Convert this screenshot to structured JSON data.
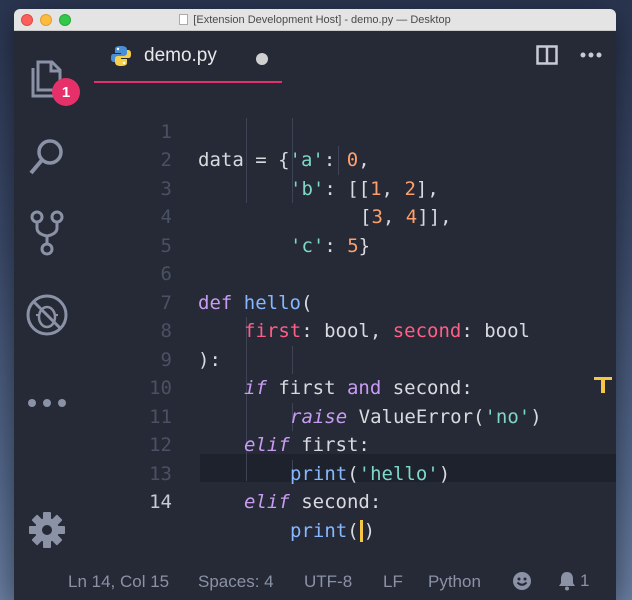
{
  "window": {
    "title": "[Extension Development Host] - demo.py — Desktop"
  },
  "activity": {
    "badge_count": "1"
  },
  "tab": {
    "label": "demo.py"
  },
  "code": {
    "lines": [
      {
        "num": "1"
      },
      {
        "num": "2"
      },
      {
        "num": "3"
      },
      {
        "num": "4"
      },
      {
        "num": "5"
      },
      {
        "num": "6"
      },
      {
        "num": "7"
      },
      {
        "num": "8"
      },
      {
        "num": "9"
      },
      {
        "num": "10"
      },
      {
        "num": "11"
      },
      {
        "num": "12"
      },
      {
        "num": "13"
      },
      {
        "num": "14"
      }
    ],
    "active_line": "14",
    "tokens": {
      "l1": [
        "data = {",
        "'a'",
        ": ",
        "0",
        ","
      ],
      "l2": [
        "'b'",
        ": [[",
        "1",
        ", ",
        "2",
        "],"
      ],
      "l3": [
        "[",
        "3",
        ", ",
        "4",
        "]],"
      ],
      "l4": [
        "'c'",
        ": ",
        "5",
        "}"
      ],
      "l6": [
        "def",
        " ",
        "hello",
        "("
      ],
      "l7": [
        "first",
        ": bool, ",
        "second",
        ": bool"
      ],
      "l8": [
        "):"
      ],
      "l9": [
        "if",
        " first ",
        "and",
        " second:"
      ],
      "l10": [
        "raise",
        " ValueError(",
        "'no'",
        ")"
      ],
      "l11": [
        "elif",
        " first:"
      ],
      "l12": [
        "print",
        "(",
        "'hello'",
        ")"
      ],
      "l13": [
        "elif",
        " second:"
      ],
      "l14": [
        "print",
        "(",
        ")"
      ]
    }
  },
  "status": {
    "position": "Ln 14, Col 15",
    "spaces": "Spaces: 4",
    "encoding": "UTF-8",
    "eol": "LF",
    "language": "Python",
    "notifications": "1"
  },
  "colors": {
    "accent": "#e5306a",
    "cursor": "#f6c744",
    "keyword": "#c89cf2",
    "function": "#86b7ff",
    "string": "#7ed7c8",
    "number": "#ff9f6a",
    "param": "#ff5e87"
  }
}
